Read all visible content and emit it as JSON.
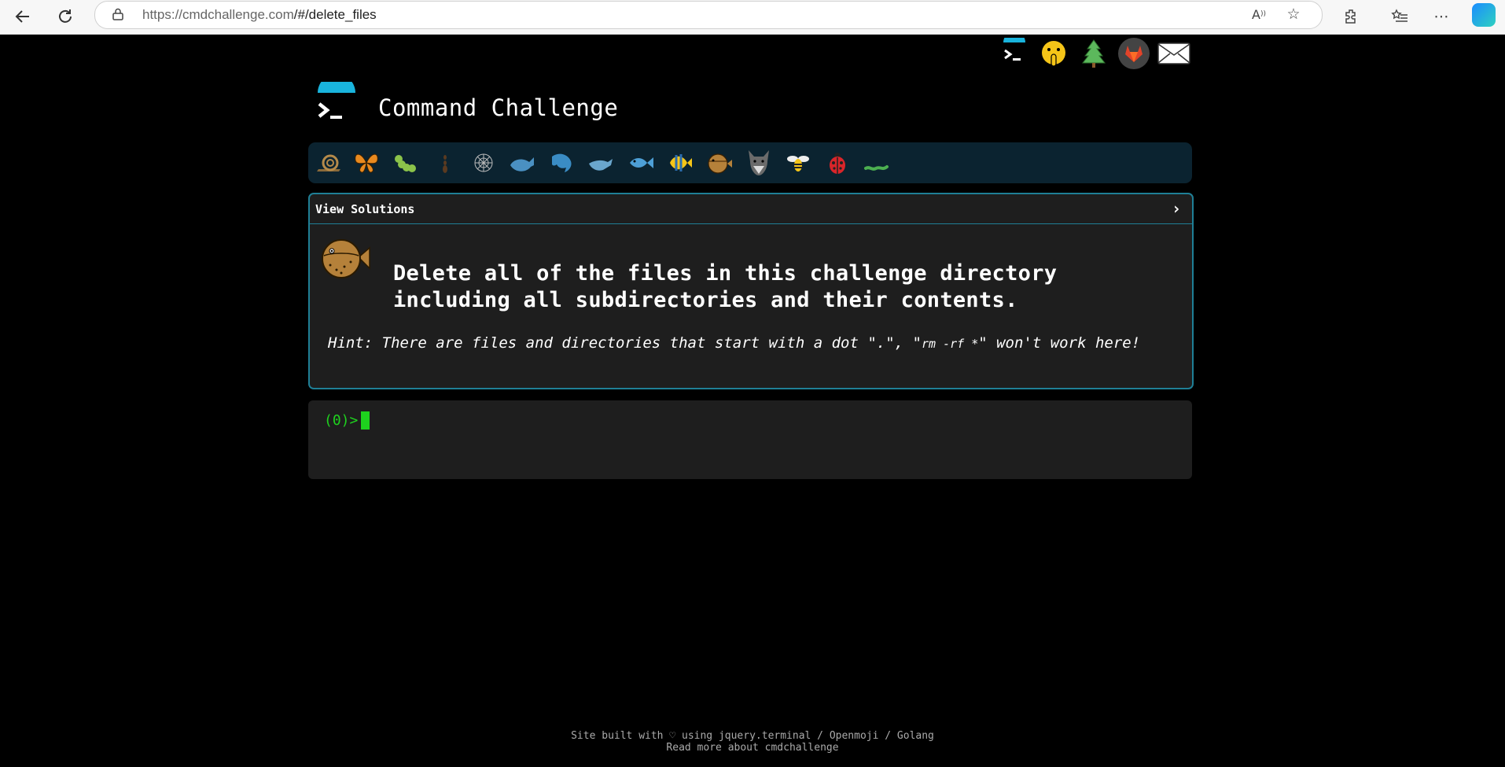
{
  "browser": {
    "url_host": "https://cmdchallenge.com",
    "url_path": "/#/delete_files"
  },
  "site": {
    "title": "Command Challenge",
    "social_icons": [
      "terminal-icon",
      "shush-face-icon",
      "tree-icon",
      "gitlab-icon",
      "mail-icon"
    ]
  },
  "challenge_bar": {
    "icons": [
      "snail",
      "butterfly",
      "caterpillar",
      "ant",
      "spider-web",
      "whale",
      "dolphin",
      "dolphin",
      "fish",
      "tropical-fish",
      "blowfish",
      "wolf",
      "bee",
      "lady-beetle",
      "worm"
    ]
  },
  "panel": {
    "header": "View Solutions",
    "challenge": "Delete all of the files in this challenge directory including all subdirectories and their contents.",
    "hint_prefix": "Hint: There are files and directories that start with a dot \".\", \"",
    "hint_cmd": "rm -rf *",
    "hint_suffix": "\" won't work here!"
  },
  "terminal": {
    "prompt": "(0)>"
  },
  "footer": {
    "line1": "Site built with ♡ using jquery.terminal / Openmoji / Golang",
    "line2": "Read more about cmdchallenge"
  }
}
